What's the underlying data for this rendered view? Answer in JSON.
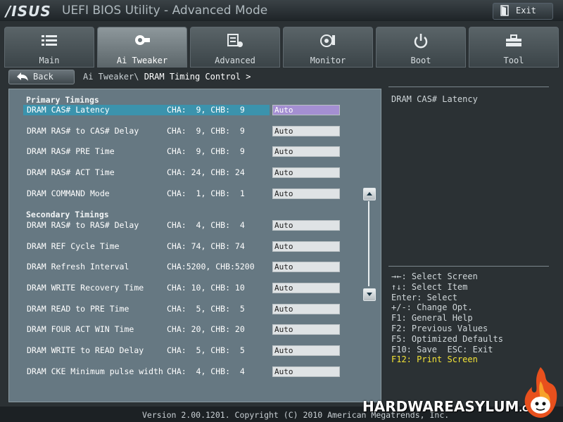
{
  "header": {
    "brand": "/ISUS",
    "title": "UEFI BIOS Utility - Advanced Mode",
    "exit_label": "Exit",
    "exit_icon": "exit-door-icon"
  },
  "tabs": [
    {
      "label": "Main",
      "icon": "list-icon",
      "active": false
    },
    {
      "label": "Ai Tweaker",
      "icon": "cpu-bulb-icon",
      "active": true
    },
    {
      "label": "Advanced",
      "icon": "chip-settings-icon",
      "active": false
    },
    {
      "label": "Monitor",
      "icon": "fan-monitor-icon",
      "active": false
    },
    {
      "label": "Boot",
      "icon": "power-icon",
      "active": false
    },
    {
      "label": "Tool",
      "icon": "toolbox-icon",
      "active": false
    }
  ],
  "breadcrumb": {
    "back_label": "Back",
    "path": "Ai Tweaker\\",
    "current": "DRAM Timing Control >"
  },
  "sections": {
    "primary": "Primary Timings",
    "secondary": "Secondary Timings"
  },
  "rows": [
    {
      "name": "DRAM CAS# Latency",
      "value": "CHA:  9, CHB:  9",
      "setting": "Auto",
      "selected": true
    },
    {
      "name": "DRAM RAS# to CAS# Delay",
      "value": "CHA:  9, CHB:  9",
      "setting": "Auto"
    },
    {
      "name": "DRAM RAS# PRE Time",
      "value": "CHA:  9, CHB:  9",
      "setting": "Auto"
    },
    {
      "name": "DRAM RAS# ACT Time",
      "value": "CHA: 24, CHB: 24",
      "setting": "Auto"
    },
    {
      "name": "DRAM COMMAND Mode",
      "value": "CHA:  1, CHB:  1",
      "setting": "Auto"
    },
    {
      "name": "DRAM RAS# to RAS# Delay",
      "value": "CHA:  4, CHB:  4",
      "setting": "Auto"
    },
    {
      "name": "DRAM REF Cycle Time",
      "value": "CHA: 74, CHB: 74",
      "setting": "Auto"
    },
    {
      "name": "DRAM Refresh Interval",
      "value": "CHA:5200, CHB:5200",
      "setting": "Auto"
    },
    {
      "name": "DRAM WRITE Recovery Time",
      "value": "CHA: 10, CHB: 10",
      "setting": "Auto"
    },
    {
      "name": "DRAM READ to PRE Time",
      "value": "CHA:  5, CHB:  5",
      "setting": "Auto"
    },
    {
      "name": "DRAM FOUR ACT WIN Time",
      "value": "CHA: 20, CHB: 20",
      "setting": "Auto"
    },
    {
      "name": "DRAM WRITE to READ Delay",
      "value": "CHA:  5, CHB:  5",
      "setting": "Auto"
    },
    {
      "name": "DRAM CKE Minimum pulse width",
      "value": "CHA:  4, CHB:  4",
      "setting": "Auto"
    }
  ],
  "help": {
    "text": "DRAM CAS# Latency",
    "keys": [
      "→←: Select Screen",
      "↑↓: Select Item",
      "Enter: Select",
      "+/-: Change Opt.",
      "F1: General Help",
      "F2: Previous Values",
      "F5: Optimized Defaults",
      "F10: Save  ESC: Exit",
      "F12: Print Screen"
    ]
  },
  "footer": {
    "version": "Version 2.00.1201. Copyright (C) 2010 American Megatrends, Inc."
  },
  "watermark": {
    "text": "HARDWAREASYLUM",
    "suffix": ".COM"
  },
  "colors": {
    "panel": "#667882",
    "highlight": "#3b93ad",
    "selected_field": "#a48fd2",
    "hotkey": "#f3e436"
  }
}
